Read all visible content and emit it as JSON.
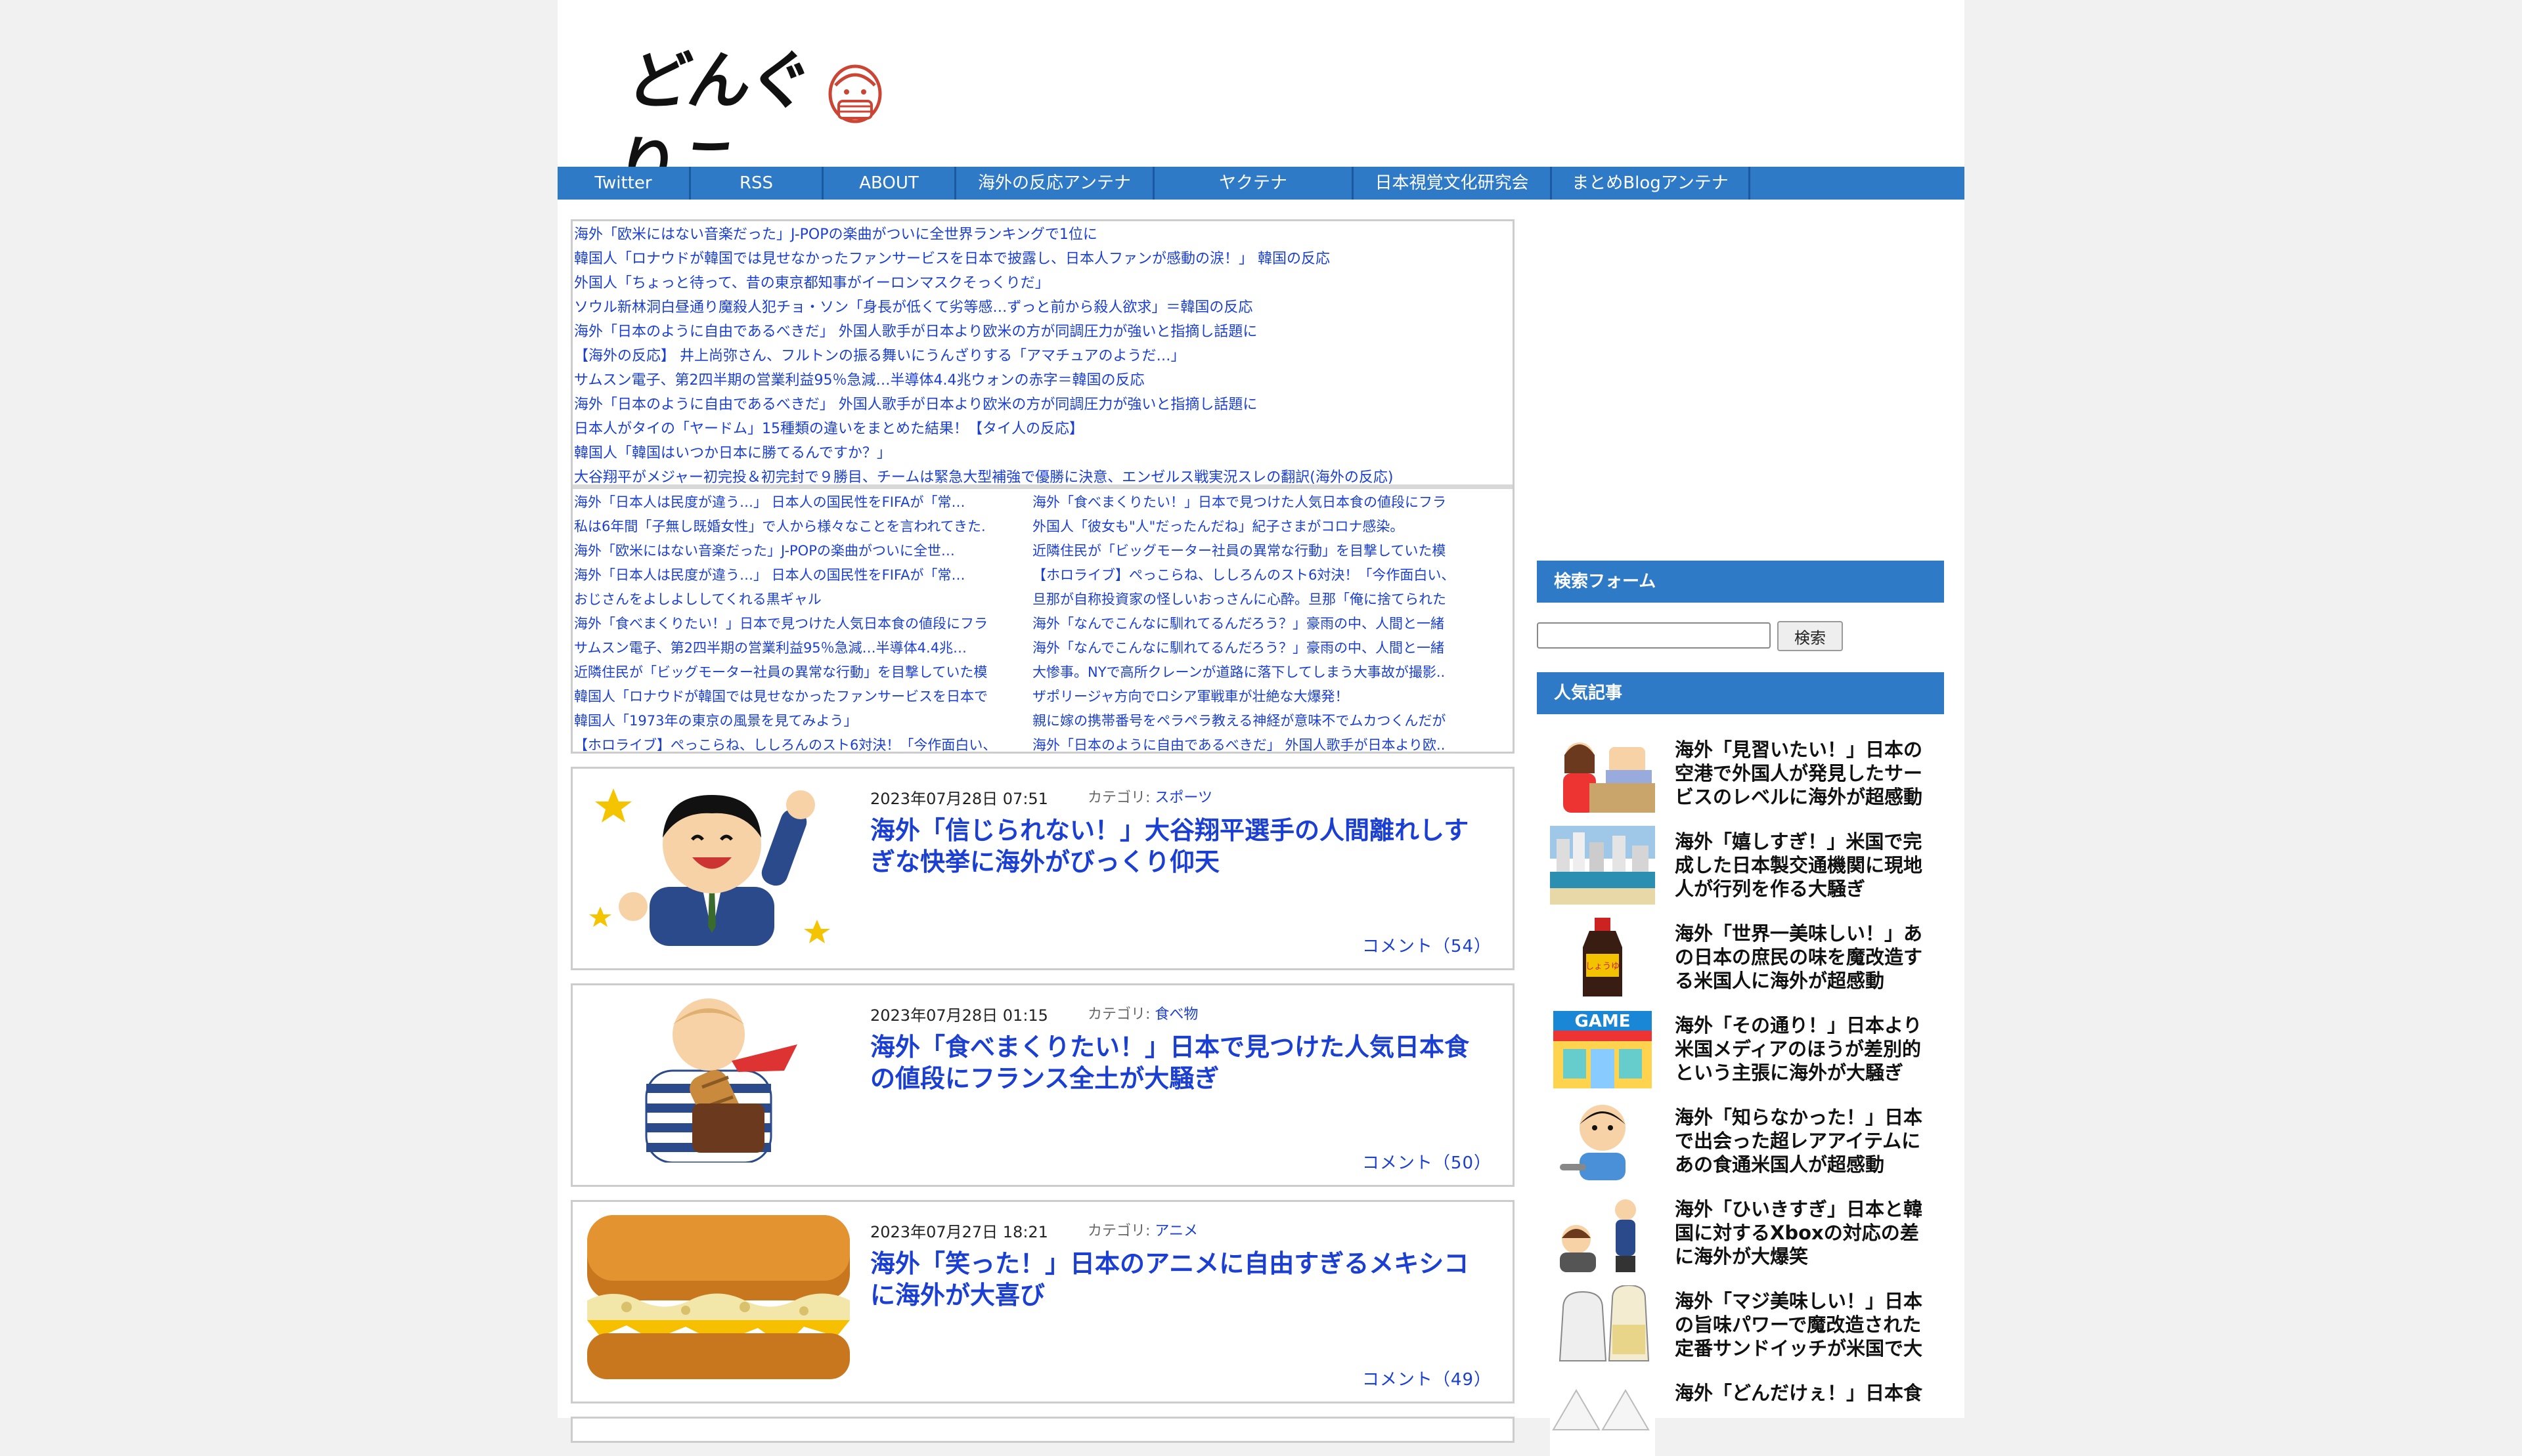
{
  "site": {
    "logo_text": "どんぐりこ"
  },
  "nav": [
    {
      "label": "Twitter"
    },
    {
      "label": "RSS"
    },
    {
      "label": "ABOUT"
    },
    {
      "label": "海外の反応アンテナ"
    },
    {
      "label": "ヤクテナ"
    },
    {
      "label": "日本視覚文化研究会"
    },
    {
      "label": "まとめBlogアンテナ"
    }
  ],
  "antenna_top": [
    "海外「欧米にはない音楽だった」J-POPの楽曲がついに全世界ランキングで1位に",
    "韓国人「ロナウドが韓国では見せなかったファンサービスを日本で披露し、日本人ファンが感動の涙！」 韓国の反応",
    "外国人「ちょっと待って、昔の東京都知事がイーロンマスクそっくりだ」",
    "ソウル新林洞白昼通り魔殺人犯チョ・ソン「身長が低くて劣等感…ずっと前から殺人欲求」＝韓国の反応",
    "海外「日本のように自由であるべきだ」 外国人歌手が日本より欧米の方が同調圧力が強いと指摘し話題に",
    "【海外の反応】 井上尚弥さん、フルトンの振る舞いにうんざりする「アマチュアのようだ…」",
    "サムスン電子、第2四半期の営業利益95％急減…半導体4.4兆ウォンの赤字＝韓国の反応",
    "海外「日本のように自由であるべきだ」 外国人歌手が日本より欧米の方が同調圧力が強いと指摘し話題に",
    "日本人がタイの「ヤードム」15種類の違いをまとめた結果！【タイ人の反応】",
    "韓国人「韓国はいつか日本に勝てるんですか？」",
    "大谷翔平がメジャー初完投＆初完封で９勝目、チームは緊急大型補強で優勝に決意、エンゼルス戦実況スレの翻訳(海外の反応)"
  ],
  "antenna_left": [
    "海外「日本人は民度が違う…」 日本人の国民性をFIFAが「常…",
    "私は6年間「子無し既婚女性」で人から様々なことを言われてきた.",
    "海外「欧米にはない音楽だった」J-POPの楽曲がついに全世…",
    "海外「日本人は民度が違う…」 日本人の国民性をFIFAが「常…",
    "おじさんをよしよししてくれる黒ギャル",
    "海外「食べまくりたい！」日本で見つけた人気日本食の値段にフラ",
    "サムスン電子、第2四半期の営業利益95％急減…半導体4.4兆…",
    "近隣住民が「ビッグモーター社員の異常な行動」を目撃していた模",
    "韓国人「ロナウドが韓国では見せなかったファンサービスを日本で",
    "韓国人「1973年の東京の風景を見てみよう」",
    "【ホロライブ】ぺっこらね、ししろんのスト6対決！「今作面白い、"
  ],
  "antenna_right": [
    "海外「食べまくりたい！」日本で見つけた人気日本食の値段にフラ",
    "外国人「彼女も\"人\"だったんだね」紀子さまがコロナ感染。",
    "近隣住民が「ビッグモーター社員の異常な行動」を目撃していた模",
    "【ホロライブ】ぺっこらね、ししろんのスト6対決！「今作面白い、",
    "旦那が自称投資家の怪しいおっさんに心酔。旦那「俺に捨てられた",
    "海外「なんでこんなに馴れてるんだろう？」豪雨の中、人間と一緒",
    "海外「なんでこんなに馴れてるんだろう？」豪雨の中、人間と一緒",
    "大惨事。NYで高所クレーンが道路に落下してしまう大事故が撮影..",
    "ザポリージャ方向でロシア軍戦車が壮絶な大爆発！",
    "親に嫁の携帯番号をペラペラ教える神経が意味不でムカつくんだが",
    "海外「日本のように自由であるべきだ」 外国人歌手が日本より欧.."
  ],
  "category_label": "カテゴリ:",
  "articles": [
    {
      "date": "2023年07月28日 07:51",
      "category": "スポーツ",
      "title": "海外「信じられない！」大谷翔平選手の人間離れしすぎな快挙に海外がびっくり仰天",
      "comments": "コメント（54）"
    },
    {
      "date": "2023年07月28日 01:15",
      "category": "食べ物",
      "title": "海外「食べまくりたい！」日本で見つけた人気日本食の値段にフランス全土が大騒ぎ",
      "comments": "コメント（50）"
    },
    {
      "date": "2023年07月27日 18:21",
      "category": "アニメ",
      "title": "海外「笑った！」日本のアニメに自由すぎるメキシコに海外が大喜び",
      "comments": "コメント（49）"
    }
  ],
  "sidebar": {
    "search_heading": "検索フォーム",
    "search_button": "検索",
    "popular_heading": "人気記事",
    "popular": [
      {
        "title": "海外「見習いたい！」日本の空港で外国人が発見したサービスのレベルに海外が超感動"
      },
      {
        "title": "海外「嬉しすぎ！」米国で完成した日本製交通機関に現地人が行列を作る大騒ぎ"
      },
      {
        "title": "海外「世界一美味しい！」あの日本の庶民の味を魔改造する米国人に海外が超感動"
      },
      {
        "title": "海外「その通り！」日本より米国メディアのほうが差別的という主張に海外が大騒ぎ"
      },
      {
        "title": "海外「知らなかった！」日本で出会った超レアアイテムにあの食通米国人が超感動"
      },
      {
        "title": "海外「ひいきすぎ」日本と韓国に対するXboxの対応の差に海外が大爆笑"
      },
      {
        "title": "海外「マジ美味しい！」日本の旨味パワーで魔改造された定番サンドイッチが米国で大"
      },
      {
        "title": "海外「どんだけぇ！」日本食"
      }
    ],
    "popular_icons": [
      "airport-counter-icon",
      "beach-resort-icon",
      "soy-sauce-bottle-icon",
      "game-shop-icon",
      "man-eating-icon",
      "gamer-bow-icon",
      "salt-shakers-icon",
      "onigiri-icon"
    ]
  },
  "colors": {
    "nav": "#2f7ac6",
    "link": "#1a3fd2",
    "background": "#f1f1f1"
  }
}
